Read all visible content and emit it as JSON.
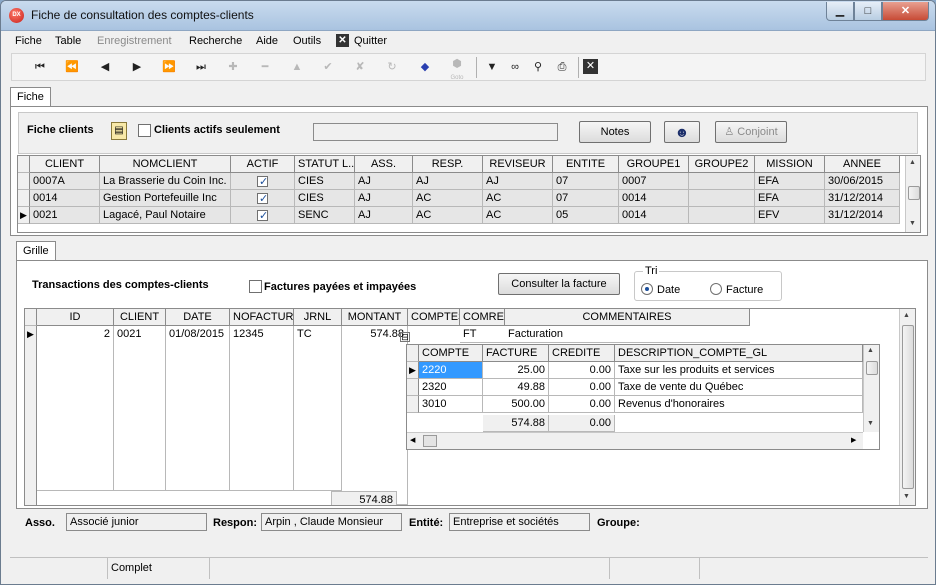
{
  "window": {
    "title": "Fiche de consultation des comptes-clients",
    "app_icon": "DX",
    "controls": {
      "minimize": "▁",
      "maximize": "□",
      "close": "✕"
    }
  },
  "menu": {
    "items": [
      "Fiche",
      "Table",
      "Enregistrement",
      "Recherche",
      "Aide",
      "Outils"
    ],
    "quit_label": "Quitter"
  },
  "toolbar": {
    "icons": [
      "first-record-icon",
      "previous-page-icon",
      "previous-record-icon",
      "next-record-icon",
      "next-page-icon",
      "last-record-icon",
      "add-icon",
      "delete-icon",
      "edit-icon",
      "save-icon",
      "cancel-icon",
      "refresh-icon",
      "eraser-icon",
      "goto-icon",
      "filter-icon",
      "binoculars-icon",
      "search-icon",
      "print-icon",
      "close-icon"
    ],
    "goto_caption": "Goto"
  },
  "tabs": {
    "fiche": "Fiche",
    "grille": "Grille"
  },
  "fiche": {
    "title": "Fiche clients",
    "active_label": "Clients actifs seulement",
    "active_checked": false,
    "search_value": "",
    "notes_label": "Notes",
    "joint_label": "Conjoint"
  },
  "clients": {
    "columns": [
      "CLIENT",
      "NOMCLIENT",
      "ACTIF",
      "STATUT L...",
      "ASS.",
      "RESP.",
      "REVISEUR",
      "ENTITE",
      "GROUPE1",
      "GROUPE2",
      "MISSION",
      "ANNEE"
    ],
    "rows": [
      {
        "client": "0007A",
        "nom": "La Brasserie du Coin Inc.",
        "actif": true,
        "statut": "CIES",
        "ass": "AJ",
        "resp": "AJ",
        "reviseur": "AJ",
        "entite": "07",
        "groupe1": "0007",
        "groupe2": "",
        "mission": "EFA",
        "annee": "30/06/2015"
      },
      {
        "client": "0014",
        "nom": "Gestion Portefeuille Inc",
        "actif": true,
        "statut": "CIES",
        "ass": "AJ",
        "resp": "AC",
        "reviseur": "AC",
        "entite": "07",
        "groupe1": "0014",
        "groupe2": "",
        "mission": "EFA",
        "annee": "31/12/2014"
      },
      {
        "client": "0021",
        "nom": "Lagacé, Paul Notaire",
        "actif": true,
        "statut": "SENC",
        "ass": "AJ",
        "resp": "AC",
        "reviseur": "AC",
        "entite": "05",
        "groupe1": "0014",
        "groupe2": "",
        "mission": "EFV",
        "annee": "31/12/2014"
      }
    ]
  },
  "grille": {
    "title": "Transactions des comptes-clients",
    "paid_label": "Factures payées et impayées",
    "paid_checked": false,
    "consult_label": "Consulter la facture",
    "tri": {
      "label": "Tri",
      "date": "Date",
      "facture": "Facture",
      "selected": "date"
    }
  },
  "transactions": {
    "columns": [
      "ID",
      "CLIENT",
      "DATE",
      "NOFACTURE",
      "JRNL",
      "MONTANT",
      "COMPTES",
      "COMREL",
      "COMMENTAIRES"
    ],
    "rows": [
      {
        "id": "2",
        "client": "0021",
        "date": "01/08/2015",
        "nofacture": "12345",
        "jrnl": "TC",
        "montant": "574.88",
        "comptes_expander": "⊟",
        "comrel": "FT",
        "commentaires": "Facturation"
      }
    ],
    "total": "574.88"
  },
  "details": {
    "columns": [
      "COMPTE",
      "FACTURE",
      "CREDITE",
      "DESCRIPTION_COMPTE_GL"
    ],
    "rows": [
      {
        "compte": "2220",
        "facture": "25.00",
        "credite": "0.00",
        "description": "Taxe sur les produits et services"
      },
      {
        "compte": "2320",
        "facture": "49.88",
        "credite": "0.00",
        "description": "Taxe de vente du Québec"
      },
      {
        "compte": "3010",
        "facture": "500.00",
        "credite": "0.00",
        "description": "Revenus d'honoraires"
      }
    ],
    "total_facture": "574.88",
    "total_credite": "0.00"
  },
  "footer": {
    "asso_label": "Asso.",
    "asso_value": "Associé junior",
    "respon_label": "Respon:",
    "respon_value": "Arpin , Claude Monsieur",
    "entite_label": "Entité:",
    "entite_value": "Entreprise et sociétés",
    "groupe_label": "Groupe:",
    "groupe_value": ""
  },
  "status": {
    "text": "Complet"
  },
  "colors": {
    "accent": "#1c4f9b",
    "title_bar": "#b7cde6"
  }
}
